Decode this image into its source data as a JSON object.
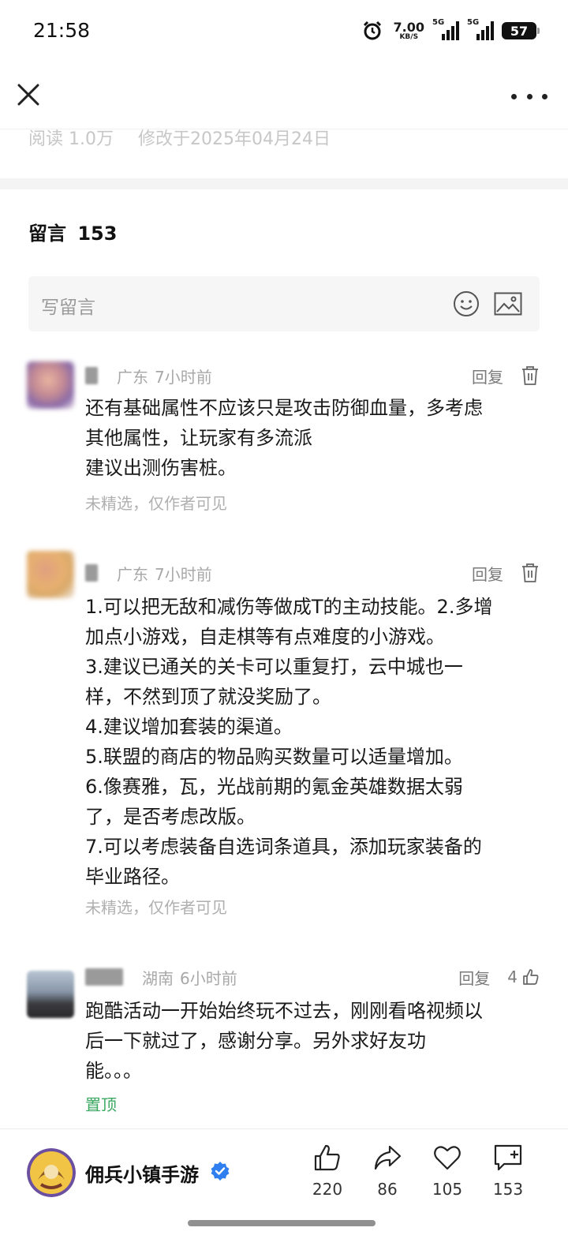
{
  "status_bar": {
    "time": "21:58",
    "net_speed": "7.00",
    "net_speed_unit": "KB/S",
    "signal_1": "5G",
    "signal_2": "5G",
    "battery": "57"
  },
  "article_meta": {
    "reads": "阅读 1.0万",
    "modified": "修改于2025年04月24日"
  },
  "comments_section": {
    "title": "留言",
    "count": "153",
    "write_placeholder": "写留言"
  },
  "comments": [
    {
      "location": "广东",
      "time": "7小时前",
      "reply_label": "回复",
      "lines": [
        "还有基础属性不应该只是攻击防御血量，多考虑",
        "其他属性，让玩家有多流派",
        "建议出测伤害桩。"
      ],
      "status": "未精选，仅作者可见"
    },
    {
      "location": "广东",
      "time": "7小时前",
      "reply_label": "回复",
      "lines": [
        "1.可以把无敌和减伤等做成T的主动技能。2.多增",
        "加点小游戏，自走棋等有点难度的小游戏。",
        "3.建议已通关的关卡可以重复打，云中城也一",
        "样，不然到顶了就没奖励了。",
        "4.建议增加套装的渠道。",
        "5.联盟的商店的物品购买数量可以适量增加。",
        "6.像赛雅，瓦，光战前期的氪金英雄数据太弱",
        "了，是否考虑改版。",
        "7.可以考虑装备自选词条道具，添加玩家装备的",
        "毕业路径。"
      ],
      "status": "未精选，仅作者可见"
    },
    {
      "location": "湖南",
      "time": "6小时前",
      "reply_label": "回复",
      "likes": "4",
      "lines": [
        "跑酷活动一开始始终玩不过去，刚刚看咯视频以",
        "后一下就过了，感谢分享。另外求好友功",
        "能。。。"
      ],
      "pinned": "置顶"
    }
  ],
  "bottom_bar": {
    "account_name": "佣兵小镇手游",
    "likes": "220",
    "shares": "86",
    "favorites": "105",
    "comments": "153"
  },
  "colors": {
    "pinned": "#3aa860",
    "verified": "#2f7ff0",
    "muted_text": "#a8a8a8"
  }
}
